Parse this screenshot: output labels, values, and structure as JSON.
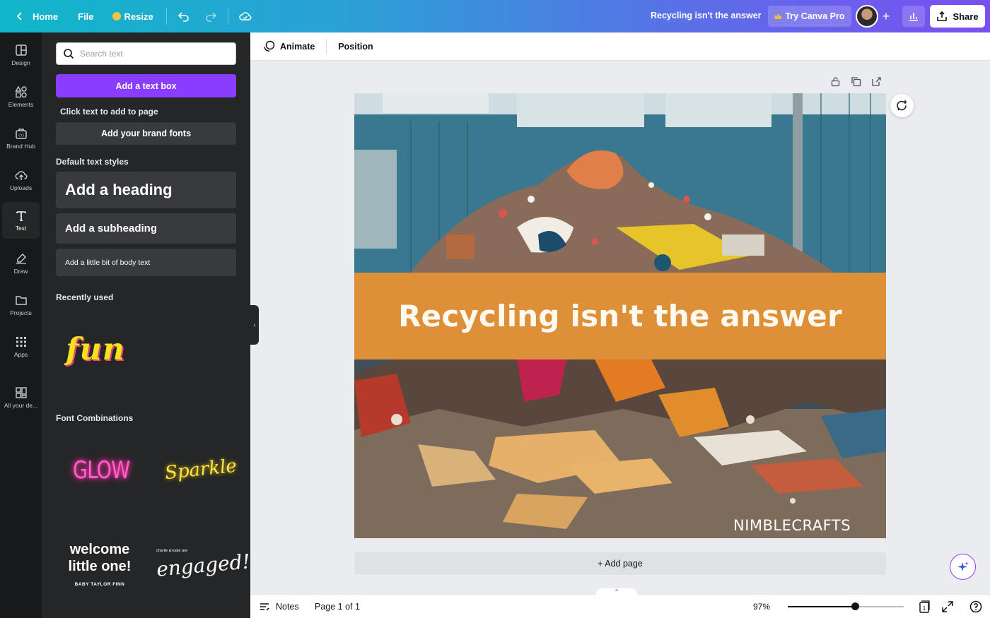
{
  "topbar": {
    "home": "Home",
    "file": "File",
    "resize": "Resize",
    "doc_title": "Recycling isn't the answer",
    "try_pro": "Try Canva Pro",
    "share": "Share",
    "add_collab": "+"
  },
  "rail": {
    "items": [
      {
        "label": "Design",
        "icon": "layout-icon"
      },
      {
        "label": "Elements",
        "icon": "shapes-icon"
      },
      {
        "label": "Brand Hub",
        "icon": "brand-icon"
      },
      {
        "label": "Uploads",
        "icon": "cloud-upload-icon"
      },
      {
        "label": "Text",
        "icon": "text-icon"
      },
      {
        "label": "Draw",
        "icon": "pen-icon"
      },
      {
        "label": "Projects",
        "icon": "folder-icon"
      },
      {
        "label": "Apps",
        "icon": "grid-icon"
      },
      {
        "label": "All your de...",
        "icon": "dashboard-icon"
      }
    ],
    "active": "Text"
  },
  "panel": {
    "search_placeholder": "Search text",
    "add_text_box": "Add a text box",
    "click_hint": "Click text to add to page",
    "brand_fonts": "Add your brand fonts",
    "default_styles_title": "Default text styles",
    "heading": "Add a heading",
    "subheading": "Add a subheading",
    "body": "Add a little bit of body text",
    "recently_used_title": "Recently used",
    "recent_sample": "fun",
    "font_combos_title": "Font Combinations",
    "combo_glow": "GLOW",
    "combo_sparkle": "Sparkle",
    "combo_welcome": "welcome little one!",
    "combo_welcome_sub": "BABY TAYLOR FINN",
    "combo_engaged_small": "charlie & katie are",
    "combo_engaged": "engaged!"
  },
  "toolbar": {
    "animate": "Animate",
    "position": "Position"
  },
  "canvas": {
    "headline": "Recycling isn't the answer",
    "brandmark": "NIMBLECRAFTS",
    "band_color": "#de9038",
    "add_page": "+ Add page"
  },
  "bottom": {
    "notes": "Notes",
    "page": "Page 1 of 1",
    "zoom_label": "97%",
    "zoom_fraction": 0.58,
    "page_count": "1"
  },
  "colors": {
    "accent": "#8b3dff",
    "panel_bg": "#252627",
    "rail_bg": "#18191b"
  }
}
